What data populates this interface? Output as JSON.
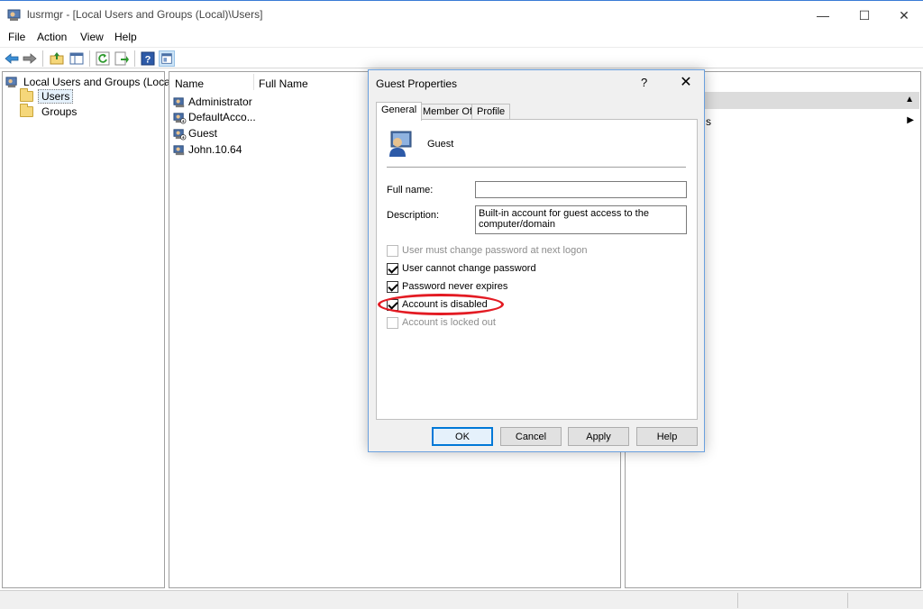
{
  "window": {
    "title": "lusrmgr - [Local Users and Groups (Local)\\Users]",
    "min_glyph": "—",
    "max_glyph": "☐",
    "close_glyph": "✕"
  },
  "menu": [
    "File",
    "Action",
    "View",
    "Help"
  ],
  "toolbar_icons": [
    "back-arrow-icon",
    "forward-arrow-icon",
    "up-folder-icon",
    "show-hide-tree-icon",
    "refresh-icon",
    "export-list-icon",
    "help-icon",
    "properties-icon"
  ],
  "tree": {
    "root": "Local Users and Groups (Local)",
    "items": [
      "Users",
      "Groups"
    ],
    "selected": "Users"
  },
  "list": {
    "columns": [
      "Name",
      "Full Name"
    ],
    "users": [
      "Administrator",
      "DefaultAcco...",
      "Guest",
      "John.10.64"
    ]
  },
  "actions": {
    "sub_fragment": "s"
  },
  "dialog": {
    "title": "Guest Properties",
    "help_glyph": "?",
    "close_glyph": "✕",
    "tabs": [
      "General",
      "Member Of",
      "Profile"
    ],
    "active_tab": "General",
    "user_name": "Guest",
    "full_name_label": "Full name:",
    "full_name_value": "",
    "description_label": "Description:",
    "description_value": "Built-in account for guest access to the computer/domain",
    "checkboxes": [
      {
        "label": "User must change password at next logon",
        "checked": false,
        "disabled": true
      },
      {
        "label": "User cannot change password",
        "checked": true,
        "disabled": false
      },
      {
        "label": "Password never expires",
        "checked": true,
        "disabled": false
      },
      {
        "label": "Account is disabled",
        "checked": true,
        "disabled": false
      },
      {
        "label": "Account is locked out",
        "checked": false,
        "disabled": true
      }
    ],
    "buttons": {
      "ok": "OK",
      "cancel": "Cancel",
      "apply": "Apply",
      "help": "Help"
    }
  },
  "colors": {
    "highlight_ellipse": "#e31b23",
    "selection": "#e5f1fb",
    "accent": "#0078d7"
  }
}
